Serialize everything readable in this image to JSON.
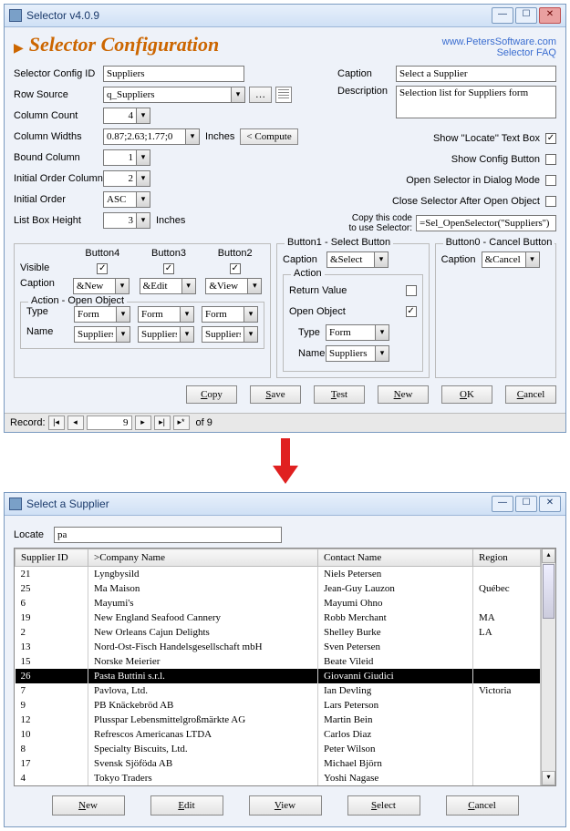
{
  "win1": {
    "title": "Selector v4.0.9",
    "heading": "Selector Configuration",
    "links": {
      "site": "www.PetersSoftware.com",
      "faq": "Selector FAQ"
    },
    "labels": {
      "configId": "Selector Config ID",
      "rowSource": "Row Source",
      "colCount": "Column Count",
      "colWidths": "Column Widths",
      "boundCol": "Bound Column",
      "initOrderCol": "Initial Order Column",
      "initOrder": "Initial Order",
      "listHeight": "List Box Height",
      "inches": "Inches",
      "compute": "< Compute",
      "caption": "Caption",
      "description": "Description",
      "showLocate": "Show ''Locate'' Text Box",
      "showConfig": "Show Config Button",
      "openDialog": "Open Selector in Dialog Mode",
      "closeAfter": "Close Selector After Open Object",
      "copyCode": "Copy this code\nto use Selector:",
      "visible": "Visible",
      "action": "Action",
      "actionOpen": "Action - Open Object",
      "returnValue": "Return Value",
      "openObject": "Open Object",
      "type": "Type",
      "name": "Name",
      "btn4": "Button4",
      "btn3": "Button3",
      "btn2": "Button2",
      "btn1": "Button1 - Select Button",
      "btn0": "Button0 - Cancel Button"
    },
    "values": {
      "configId": "Suppliers",
      "rowSource": "q_Suppliers",
      "colCount": "4",
      "colWidths": "0.87;2.63;1.77;0",
      "boundCol": "1",
      "initOrderCol": "2",
      "initOrder": "ASC",
      "listHeight": "3",
      "caption": "Select a Supplier",
      "description": "Selection list for Suppliers form",
      "copyCode": "=Sel_OpenSelector(''Suppliers'')",
      "showLocate": true,
      "showConfig": false,
      "openDialog": false,
      "closeAfter": false,
      "btn4": {
        "visible": true,
        "caption": "&New",
        "type": "Form",
        "name": "Suppliers"
      },
      "btn3": {
        "visible": true,
        "caption": "&Edit",
        "type": "Form",
        "name": "Suppliers"
      },
      "btn2": {
        "visible": true,
        "caption": "&View",
        "type": "Form",
        "name": "Suppliers"
      },
      "btn1": {
        "caption": "&Select",
        "returnValue": false,
        "openObject": true,
        "type": "Form",
        "name": "Suppliers"
      },
      "btn0": {
        "caption": "&Cancel"
      }
    },
    "botBtns": {
      "copy": "Copy",
      "save": "Save",
      "test": "Test",
      "new": "New",
      "ok": "OK",
      "cancel": "Cancel"
    },
    "rec": {
      "label": "Record:",
      "current": "9",
      "of": "of  9"
    }
  },
  "win2": {
    "title": "Select a Supplier",
    "locateLabel": "Locate",
    "locateValue": "pa",
    "cols": [
      "Supplier ID",
      ">Company Name",
      "Contact Name",
      "Region"
    ],
    "rows": [
      {
        "id": "21",
        "co": "Lyngbysild",
        "cn": "Niels Petersen",
        "rg": ""
      },
      {
        "id": "25",
        "co": "Ma Maison",
        "cn": "Jean-Guy Lauzon",
        "rg": "Québec"
      },
      {
        "id": "6",
        "co": "Mayumi's",
        "cn": "Mayumi Ohno",
        "rg": ""
      },
      {
        "id": "19",
        "co": "New England Seafood Cannery",
        "cn": "Robb Merchant",
        "rg": "MA"
      },
      {
        "id": "2",
        "co": "New Orleans Cajun Delights",
        "cn": "Shelley Burke",
        "rg": "LA"
      },
      {
        "id": "13",
        "co": "Nord-Ost-Fisch Handelsgesellschaft mbH",
        "cn": "Sven Petersen",
        "rg": ""
      },
      {
        "id": "15",
        "co": "Norske Meierier",
        "cn": "Beate Vileid",
        "rg": ""
      },
      {
        "id": "26",
        "co": "Pasta Buttini s.r.l.",
        "cn": "Giovanni Giudici",
        "rg": "",
        "sel": true
      },
      {
        "id": "7",
        "co": "Pavlova, Ltd.",
        "cn": "Ian Devling",
        "rg": "Victoria"
      },
      {
        "id": "9",
        "co": "PB Knäckebröd AB",
        "cn": "Lars Peterson",
        "rg": ""
      },
      {
        "id": "12",
        "co": "Plusspar Lebensmittelgroßmärkte AG",
        "cn": "Martin Bein",
        "rg": ""
      },
      {
        "id": "10",
        "co": "Refrescos Americanas LTDA",
        "cn": "Carlos Diaz",
        "rg": ""
      },
      {
        "id": "8",
        "co": "Specialty Biscuits, Ltd.",
        "cn": "Peter Wilson",
        "rg": ""
      },
      {
        "id": "17",
        "co": "Svensk Sjöföda AB",
        "cn": "Michael Björn",
        "rg": ""
      },
      {
        "id": "4",
        "co": "Tokyo Traders",
        "cn": "Yoshi Nagase",
        "rg": ""
      }
    ],
    "btns": {
      "new": "New",
      "edit": "Edit",
      "view": "View",
      "select": "Select",
      "cancel": "Cancel"
    }
  }
}
